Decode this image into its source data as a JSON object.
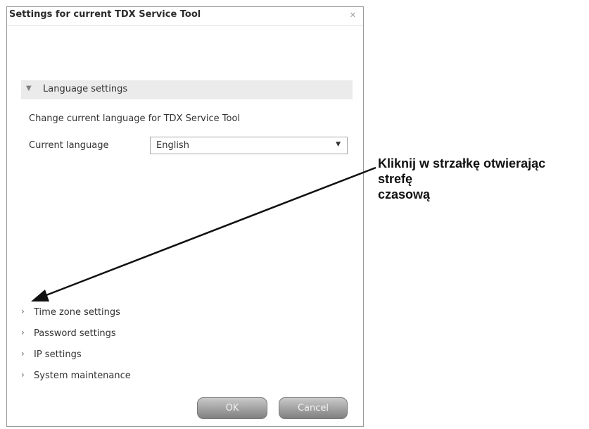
{
  "dialog": {
    "title": "Settings for current TDX Service Tool",
    "close_glyph": "×"
  },
  "language_section": {
    "label": "Language settings",
    "description": "Change current language for TDX Service Tool",
    "current_language_label": "Current language",
    "current_language_value": "English"
  },
  "collapsed_sections": [
    {
      "label": "Time zone settings"
    },
    {
      "label": "Password settings"
    },
    {
      "label": "IP settings"
    },
    {
      "label": "System maintenance"
    }
  ],
  "buttons": {
    "ok": "OK",
    "cancel": "Cancel"
  },
  "annotation": {
    "line1": "Kliknij w strzałkę otwierając",
    "line2": "strefę",
    "line3": "czasową"
  },
  "icons": [
    "close-icon",
    "chevron-down-icon",
    "chevron-right-icon",
    "dropdown-arrow-icon",
    "arrow-annotation"
  ]
}
